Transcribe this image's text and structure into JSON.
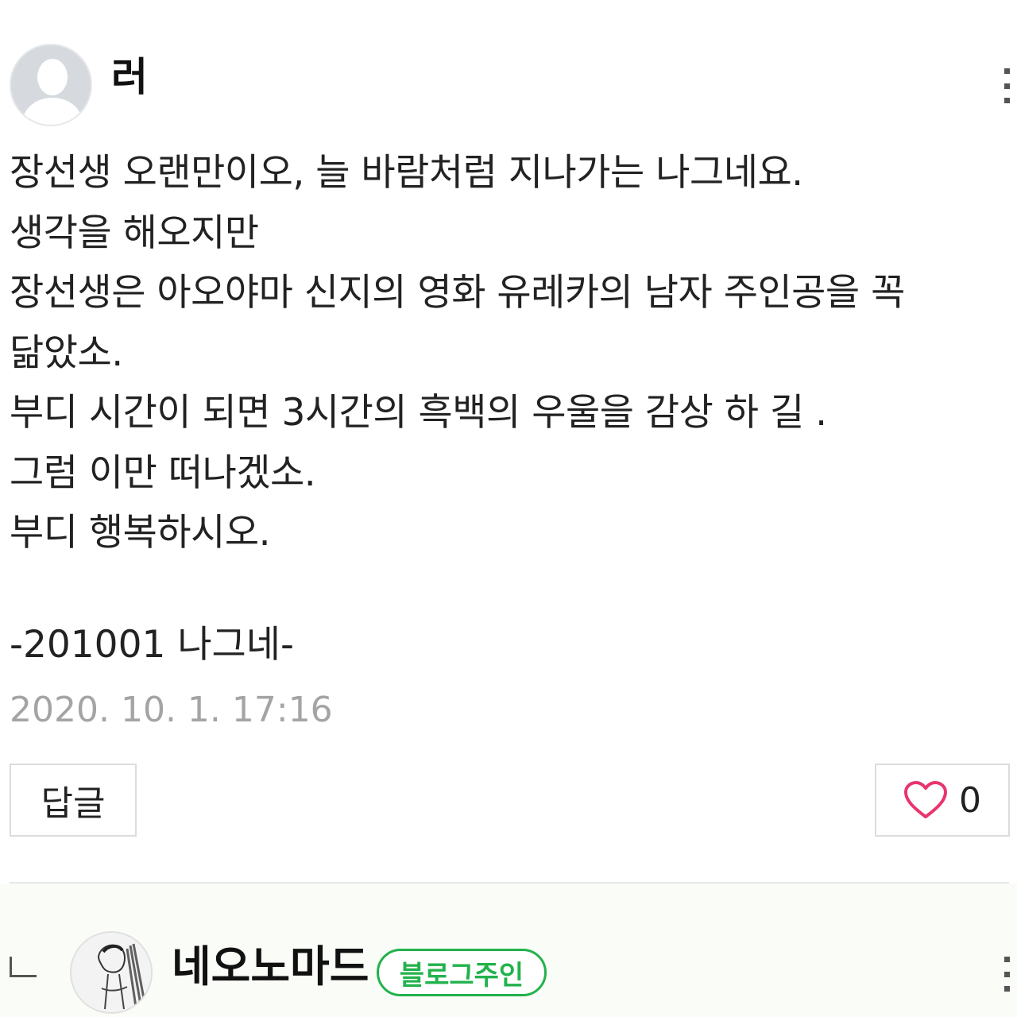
{
  "comment": {
    "author": "러",
    "body_lines": [
      "장선생 오랜만이오, 늘 바람처럼 지나가는 나그네요.",
      "생각을 해오지만",
      "장선생은 아오야마 신지의 영화 유레카의 남자 주인공을 꼭",
      "닮았소.",
      "부디 시간이 되면 3시간의 흑백의 우울을 감상 하 길 .",
      "그럼 이만 떠나겠소.",
      "부디 행복하시오."
    ],
    "signature": "-201001 나그네-",
    "timestamp": "2020. 10. 1. 17:16",
    "reply_label": "답글",
    "like_count": "0"
  },
  "reply": {
    "author": "네오노마드",
    "badge": "블로그주인"
  },
  "colors": {
    "heart": "#e8356d",
    "owner_badge": "#22b24c",
    "timestamp": "#a4a4a4"
  },
  "icons": {
    "avatar": "default-user-silhouette-icon",
    "heart": "heart-outline-icon",
    "more": "vertical-ellipsis-icon",
    "reply_indent": "reply-indent-icon"
  }
}
